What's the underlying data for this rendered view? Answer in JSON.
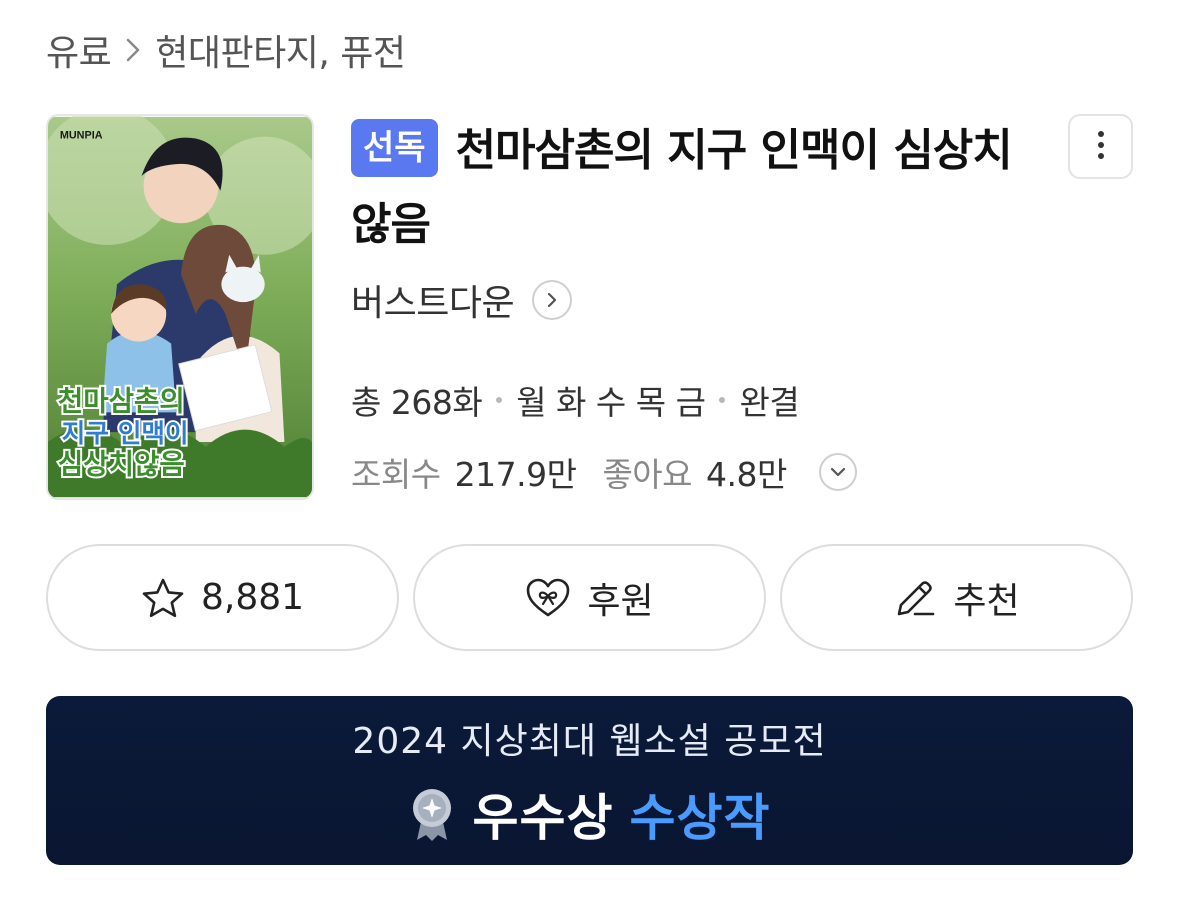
{
  "breadcrumb": {
    "items": [
      "유료",
      "현대판타지, 퓨전"
    ]
  },
  "cover": {
    "publisher_logo": "MUNPIA",
    "title_line1": "천마삼촌의",
    "title_line2": "지구 인맥이",
    "title_line3": "심상치않음"
  },
  "book": {
    "badge": "선독",
    "title": "천마삼촌의 지구 인맥이 심상치않음",
    "author": "버스트다운",
    "episodes": "총 268화",
    "schedule": "월 화 수 목 금",
    "status": "완결",
    "views_label": "조회수",
    "views_value": "217.9만",
    "likes_label": "좋아요",
    "likes_value": "4.8만"
  },
  "actions": {
    "favorite_count": "8,881",
    "support_label": "후원",
    "recommend_label": "추천"
  },
  "banner": {
    "subtitle": "2024 지상최대 웹소설 공모전",
    "award": "우수상",
    "award_suffix": "수상작"
  },
  "colors": {
    "badge": "#5a78f0",
    "banner_bg": "#0b1a3a",
    "banner_accent": "#4a9bff"
  },
  "icons": [
    "chevron-right-icon",
    "more-vertical-icon",
    "star-icon",
    "heart-ribbon-icon",
    "pencil-icon",
    "chevron-down-icon",
    "medal-icon"
  ]
}
